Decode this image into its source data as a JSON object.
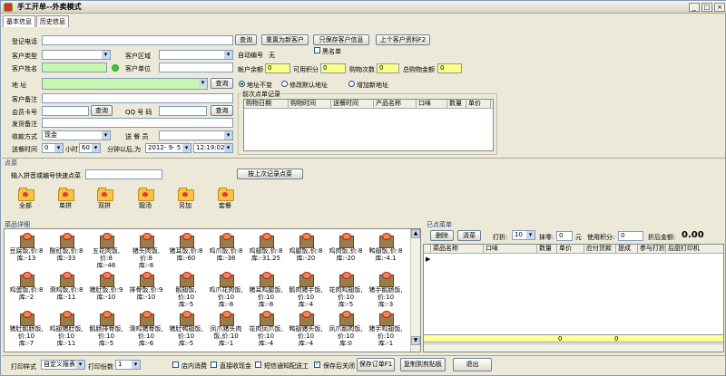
{
  "window": {
    "title": "手工开单--外卖模式"
  },
  "tabs": [
    "基本信息",
    "历史信息"
  ],
  "form": {
    "phone_label": "登记电话",
    "query_label": "查询",
    "reset_label": "重置为新客户",
    "save_only_label": "只保存客户信息",
    "prev_customer_label": "上个客户资料F2",
    "type_label": "客户类型",
    "region_label": "客户区域",
    "auto_no_label": "自动编号",
    "auto_no_value": "无",
    "blacklist_label": "黑名单",
    "name_label": "客户姓名",
    "unit_label": "客户单位",
    "balance_label": "帐户余额",
    "balance_value": "0",
    "points_label": "可用积分",
    "points_value": "0",
    "count_label": "购物次数",
    "count_value": "0",
    "total_label": "总购物金额",
    "total_value": "0",
    "addr_label": "地    址",
    "addr_query": "查询",
    "addr_opt1": "地址不变",
    "addr_opt2": "修改默认地址",
    "addr_opt3": "增加新地址",
    "note_label": "客户备注",
    "member_label": "会员卡号",
    "member_query": "查询",
    "qq_label": "QQ 号 码",
    "qq_query": "查询",
    "ship_note_label": "发货备注",
    "pay_label": "收款方式",
    "pay_value": "现金",
    "courier_label": "送 餐 员",
    "deliver_label": "送餐时间",
    "deliver_hours": "0",
    "hours_unit": "小时",
    "deliver_mins": "60",
    "mins_unit": "分钟以后,为",
    "deliver_date": "2012- 9- 5",
    "deliver_time": "12:19:02"
  },
  "recent": {
    "title": "前次点单记录",
    "columns": [
      "购物日期",
      "购物时间",
      "送餐时间",
      "产品名称",
      "口味",
      "数量",
      "单价"
    ]
  },
  "order": {
    "section_title": "点菜",
    "search_label": "输入拼音或编号快速点菜",
    "last_record_btn": "按上次记录点菜"
  },
  "categories": [
    "全部",
    "单拼",
    "双拼",
    "靓汤",
    "另加",
    "套餐"
  ],
  "dishes_title": "菜品详细",
  "dishes": [
    [
      "豆腐饭,价:8,库:-13",
      "酸豇饭,价:8,库:-33",
      "五花肉饭,价:8,库:-46",
      "猪头肉饭,价:8,库:-8",
      "猪耳饭,价:8,库:-60",
      "鸡爪饭,价:8,库:-38",
      "鸡翅饭,价:8,库:-31.25",
      "鸡腿饭,价:8,库:-20",
      "鸡肉饭,价:8,库:-20",
      "鸭翅饭,价:8,库:-4.1"
    ],
    [
      "鸡蛋饭,价:8,库:-2",
      "滑鸡饭,价:8,库:-11",
      "猪肚饭,价:9,库:-10",
      "排骨饭,价:9,库:-10",
      "鹅翅饭,价:10,库:-5",
      "鸡爪花肉饭,价:10,库:-8",
      "猪耳鸡腿饭,价:10,库:-8",
      "鹅肉猪手饭,价:10,库:-4",
      "花肉鸡翅饭,价:10,库:-5",
      "猪手鹅肠饭,价:10,库:-3"
    ],
    [
      "猪肚鹅肠饭,价:10,库:-7",
      "鸡翅猪肚饭,价:10,库:-11",
      "鹅肠排骨饭,价:10,库:-5",
      "滑鸡猪骨饭,价:10,库:-6",
      "猪肚鸭翅饭,价:10,库:-5",
      "凤爪猪头肉饭,价:10,库:-1",
      "花肉凤爪饭,价:10,库:-4",
      "鸭翅猪头饭,价:10,库:-4",
      "凤爪鹅肉饭,价:10,库:0",
      "猪手鸡翅饭,价:10,库:-1"
    ]
  ],
  "selected": {
    "title": "已点菜单",
    "delete_btn": "删除",
    "clear_btn": "清菜",
    "discount_label": "打折:",
    "discount_value": "10",
    "remove_zero_label": "抹零:",
    "remove_zero_value": "0",
    "yuan": "元",
    "points_use_label": "使用积分:",
    "points_use_value": "0",
    "after_label": "折后金额:",
    "after_value": "0.00",
    "columns": [
      "菜品名称",
      "口味",
      "数量",
      "单价",
      "应付贷款",
      "提成",
      "参与打折",
      "后厨打印机"
    ],
    "sum_qty": "0",
    "sum_amt": "0"
  },
  "footer": {
    "print_style_label": "打印样式",
    "print_style_value": "自定义报表",
    "copies_label": "打印份数",
    "copies_value": "1",
    "dine_in_label": "店内消费",
    "direct_pay_label": "直接收现金",
    "sms_label": "短信通知配送工",
    "save_close_label": "保存后关闭",
    "save_btn": "保存订单F1",
    "copy_btn": "复制到剪贴板",
    "exit_btn": "退出"
  }
}
